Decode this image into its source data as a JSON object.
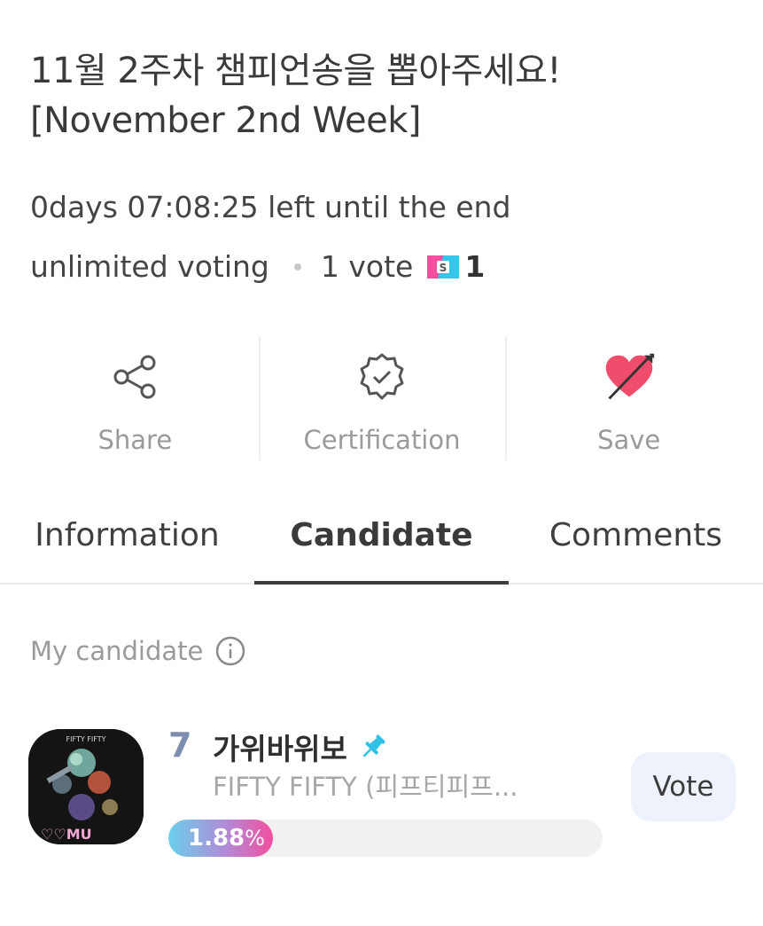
{
  "header": {
    "title_line1": "11월 2주차 챔피언송을 뽑아주세요!",
    "title_line2": "[November 2nd Week]",
    "time_left": "0days 07:08:25 left until the end",
    "voting_type": "unlimited voting",
    "vote_cost": "1 vote",
    "coin_icon": "s-coin-icon",
    "coin_amount": "1"
  },
  "actions": [
    {
      "label": "Share",
      "icon": "share-icon"
    },
    {
      "label": "Certification",
      "icon": "certification-badge-icon"
    },
    {
      "label": "Save",
      "icon": "heart-arrow-icon"
    }
  ],
  "tabs": [
    {
      "label": "Information",
      "active": false
    },
    {
      "label": "Candidate",
      "active": true
    },
    {
      "label": "Comments",
      "active": false
    }
  ],
  "section": {
    "my_candidate_label": "My candidate",
    "info_icon": "info-icon"
  },
  "candidate": {
    "rank": "7",
    "song": "가위바위보",
    "pin_icon": "pin-icon",
    "artist": "FIFTY FIFTY (피프티피프...",
    "percent_value": "1.88",
    "percent_sign": "%",
    "percent_fraction": 0.0188,
    "vote_button": "Vote"
  },
  "colors": {
    "accent_pink": "#f34f9e",
    "accent_cyan": "#69d0ea",
    "rank_color": "#7d8db0",
    "heart": "#f04d6d"
  }
}
